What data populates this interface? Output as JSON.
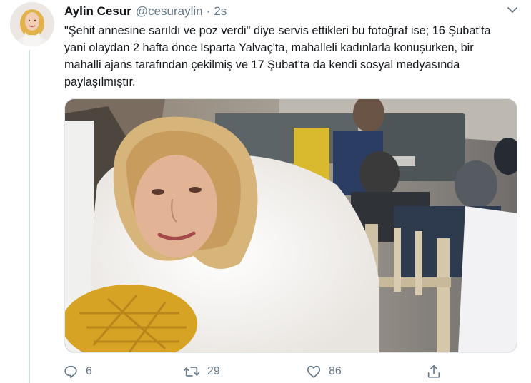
{
  "user": {
    "name": "Aylin Cesur",
    "handle": "@cesuraylin",
    "separator": "·",
    "time": "2s"
  },
  "tweet": {
    "text": "\"Şehit annesine sarıldı ve poz verdi\" diye servis ettikleri bu fotoğraf ise; 16 Şubat'ta yani olaydan 2 hafta önce Isparta Yalvaç'ta, mahalleli kadınlarla konuşurken, bir mahalli ajans tarafından çekilmiş ve 17 Şubat'ta da kendi sosyal medyasında paylaşılmıştır."
  },
  "actions": {
    "replies": "6",
    "retweets": "29",
    "likes": "86"
  },
  "icons": {
    "avatar": "avatar",
    "menu": "chevron-down-icon",
    "reply": "reply-icon",
    "retweet": "retweet-icon",
    "like": "heart-icon",
    "share": "share-icon"
  },
  "colors": {
    "secondary_text": "#657786",
    "primary_text": "#14171a",
    "border": "#e1e8ed"
  }
}
